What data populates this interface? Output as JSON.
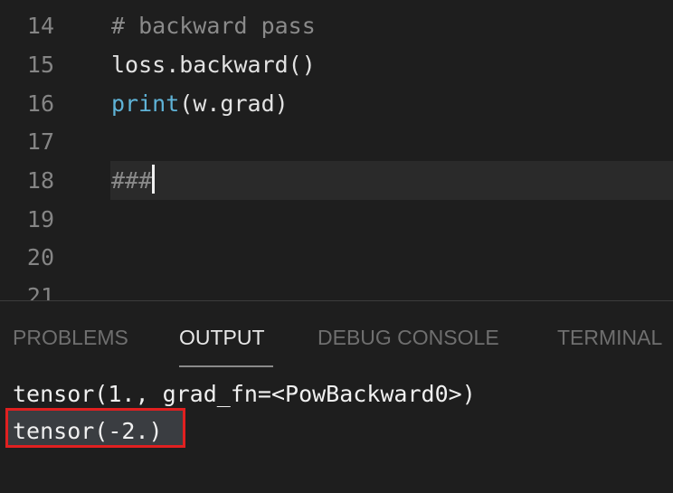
{
  "editor": {
    "lines": [
      {
        "number": "14",
        "text": "# backward pass"
      },
      {
        "number": "15",
        "text": "loss.backward()"
      },
      {
        "number": "16",
        "builtin": "print",
        "rest": "(w.grad)"
      },
      {
        "number": "17",
        "text": ""
      },
      {
        "number": "18",
        "text": "###"
      },
      {
        "number": "19",
        "text": ""
      },
      {
        "number": "20",
        "text": ""
      },
      {
        "number": "21",
        "text": ""
      }
    ]
  },
  "panel": {
    "tabs": {
      "problems": "PROBLEMS",
      "output": "OUTPUT",
      "debug_console": "DEBUG CONSOLE",
      "terminal": "TERMINAL"
    },
    "active_tab": "OUTPUT",
    "output_lines": [
      "tensor(1., grad_fn=<PowBackward0>)",
      "tensor(-2.)"
    ]
  },
  "colors": {
    "editor_background": "#1e1e1e",
    "comment": "#8a8a8a",
    "builtin": "#5fb3d7",
    "annotation_box": "#e02020"
  }
}
